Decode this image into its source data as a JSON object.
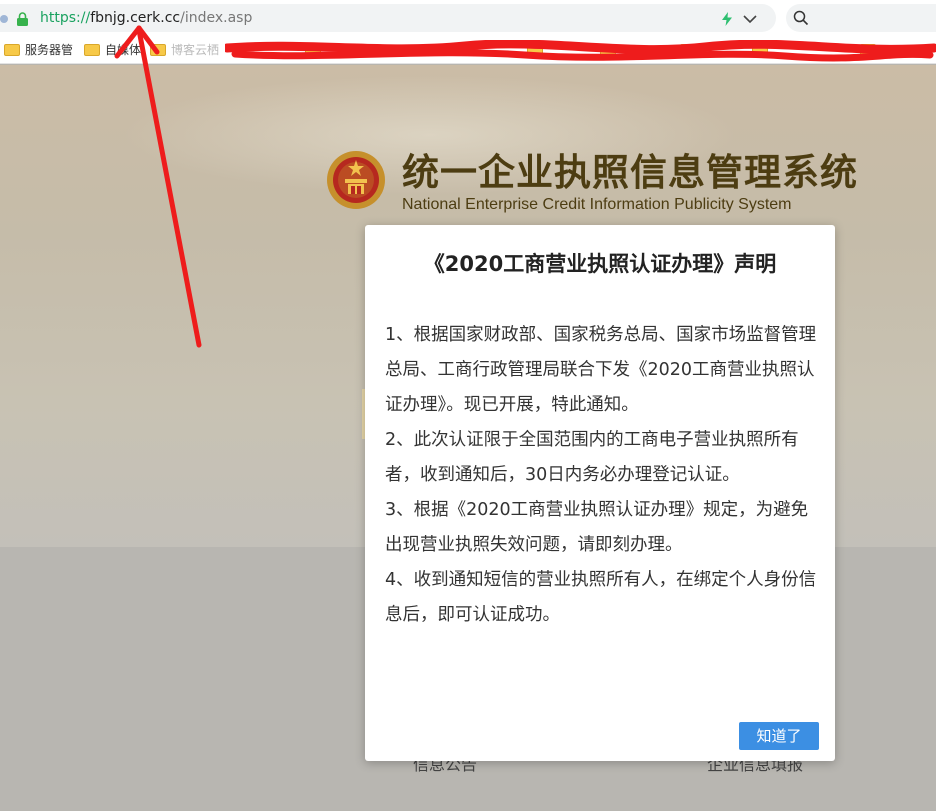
{
  "browser": {
    "url_scheme": "https://",
    "url_host": "fbnjg.cerk.cc",
    "url_path": "/index.asp",
    "bookmarks": [
      {
        "label": "服务器管"
      },
      {
        "label": "自媒体"
      },
      {
        "label": "博客云栖"
      }
    ],
    "icons": [
      "lock-icon",
      "lightning-icon",
      "chevron-down-icon",
      "search-icon",
      "folder-icon"
    ]
  },
  "site": {
    "title_cn": "统一企业执照信息管理系统",
    "title_en": "National Enterprise Credit Information Publicity System",
    "peek_left": "信息公告",
    "peek_right": "企业信息填报"
  },
  "modal": {
    "title": "《2020工商营业执照认证办理》声明",
    "paragraphs": [
      "1、根据国家财政部、国家税务总局、国家市场监督管理总局、工商行政管理局联合下发《2020工商营业执照认证办理》。现已开展，特此通知。",
      "2、此次认证限于全国范围内的工商电子营业执照所有者，收到通知后，30日内务必办理登记认证。",
      "3、根据《2020工商营业执照认证办理》规定，为避免出现营业执照失效问题，请即刻办理。",
      "4、收到通知短信的营业执照所有人，在绑定个人身份信息后，即可认证成功。"
    ],
    "ok_label": "知道了"
  },
  "colors": {
    "accent": "#3c8fe3",
    "annotation": "#ee1c1c",
    "title_brown": "#4d3d12"
  }
}
